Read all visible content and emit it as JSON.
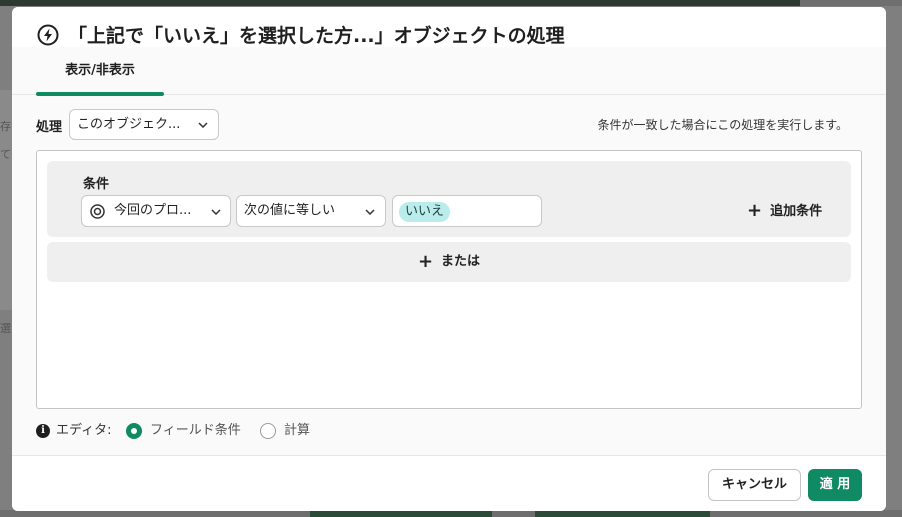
{
  "background": {
    "partial_labels": [
      "存",
      "て",
      "選"
    ]
  },
  "dialog": {
    "title_icon": "lightning-circle-icon",
    "title": "「上記で「いいえ」を選択した方...」オブジェクトの処理"
  },
  "tabs": [
    {
      "label": "表示/非表示",
      "active": true
    }
  ],
  "processing": {
    "label": "処理",
    "selected": "このオブジェク...",
    "help_text": "条件が一致した場合にこの処理を実行します。"
  },
  "condition": {
    "label": "条件",
    "field_icon": "target-icon",
    "field": "今回のプロ...",
    "operator": "次の値に等しい",
    "value_chip": "いいえ",
    "add_condition": "追加条件"
  },
  "or_button": "または",
  "editor": {
    "info_icon": "info-icon",
    "label": "エディタ:",
    "options": [
      {
        "label": "フィールド条件",
        "selected": true
      },
      {
        "label": "計算",
        "selected": false
      }
    ]
  },
  "footer": {
    "cancel": "キャンセル",
    "apply": "適 用"
  },
  "colors": {
    "accent": "#0f8a63",
    "chip": "#b9ecea"
  }
}
